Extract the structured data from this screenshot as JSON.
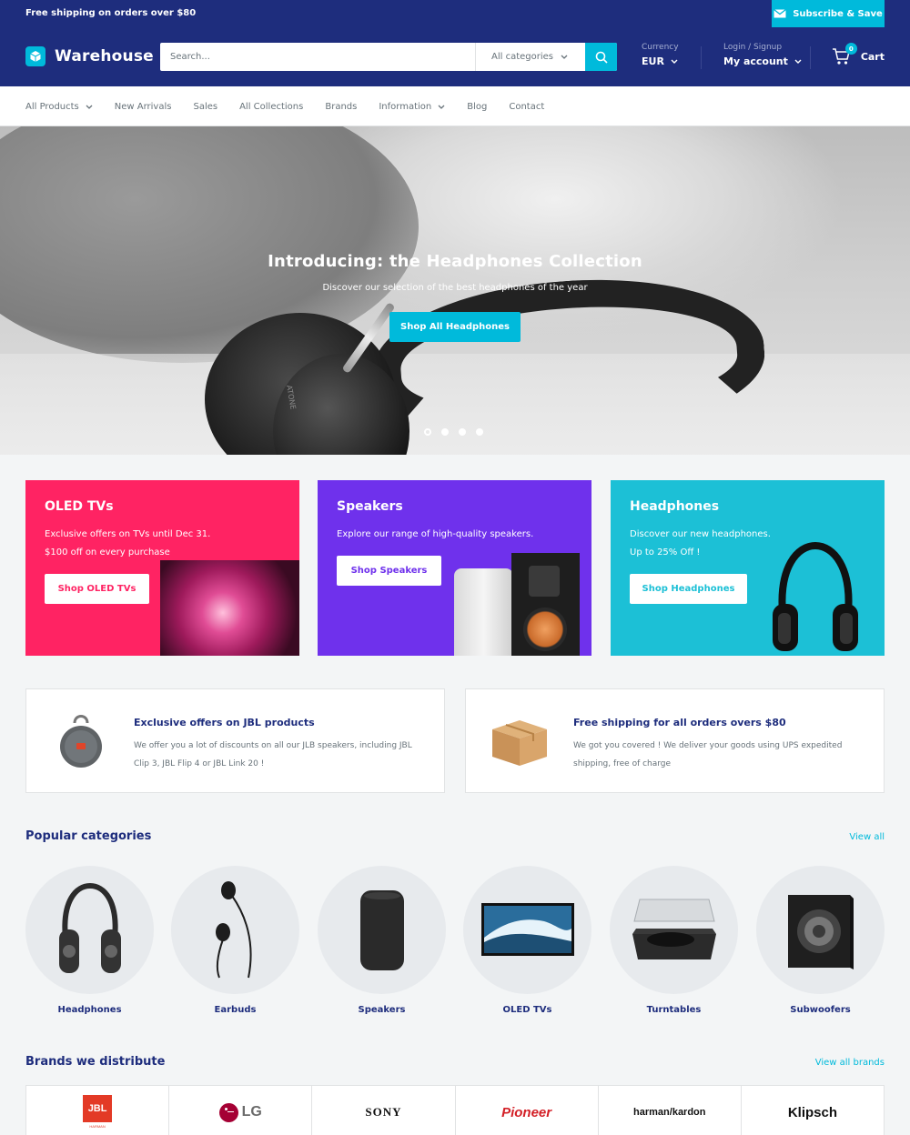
{
  "announcement": {
    "text": "Free shipping on orders over $80",
    "subscribe_label": "Subscribe & Save"
  },
  "header": {
    "logo_text": "Warehouse",
    "search_placeholder": "Search...",
    "search_category": "All categories",
    "currency_label": "Currency",
    "currency_value": "EUR",
    "account_label": "Login / Signup",
    "account_value": "My account",
    "cart_label": "Cart",
    "cart_count": "0"
  },
  "nav": {
    "items": [
      "All Products",
      "New Arrivals",
      "Sales",
      "All Collections",
      "Brands",
      "Information",
      "Blog",
      "Contact"
    ]
  },
  "hero": {
    "title": "Introducing: the Headphones Collection",
    "subtitle": "Discover our selection of the best headphones of the year",
    "button": "Shop All Headphones",
    "headphone_text": "ATONE"
  },
  "promos": [
    {
      "title": "OLED TVs",
      "line1": "Exclusive offers on TVs until Dec 31.",
      "line2": "$100 off on every purchase",
      "button": "Shop OLED TVs",
      "color": "#ff2363"
    },
    {
      "title": "Speakers",
      "line1": "Explore our range of high-quality speakers.",
      "line2": "",
      "button": "Shop Speakers",
      "color": "#6f31ec"
    },
    {
      "title": "Headphones",
      "line1": "Discover our new headphones.",
      "line2": "Up to 25% Off !",
      "button": "Shop Headphones",
      "color": "#1cc0d6"
    }
  ],
  "info": [
    {
      "title": "Exclusive offers on JBL products",
      "text": "We offer you a lot of discounts on all our JLB speakers, including JBL Clip 3, JBL Flip 4 or JBL Link 20 !"
    },
    {
      "title": "Free shipping for all orders overs $80",
      "text": "We got you covered ! We deliver your goods using UPS expedited shipping, free of charge"
    }
  ],
  "categories": {
    "title": "Popular categories",
    "view_all": "View all",
    "items": [
      "Headphones",
      "Earbuds",
      "Speakers",
      "OLED TVs",
      "Turntables",
      "Subwoofers"
    ]
  },
  "brands": {
    "title": "Brands we distribute",
    "view_all": "View all brands",
    "items": [
      "JBL",
      "LG",
      "SONY",
      "Pioneer",
      "harman/kardon",
      "Klipsch"
    ],
    "jbl_sub": "HARMAN"
  },
  "colors": {
    "primary": "#1e2d7d",
    "accent": "#00badb",
    "muted_text": "#677279"
  }
}
